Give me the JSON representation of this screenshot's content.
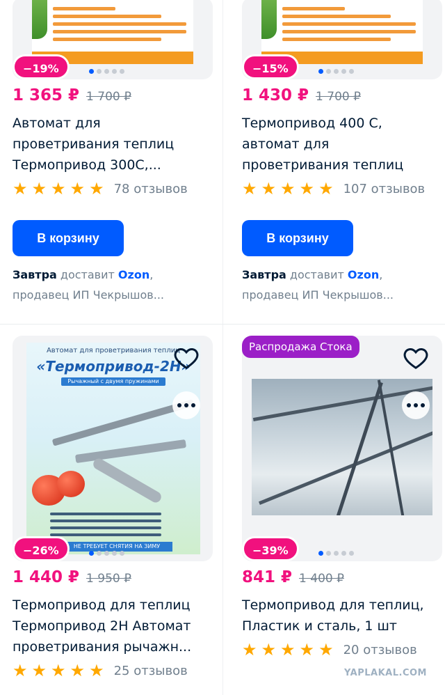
{
  "products": [
    {
      "discount": "−19%",
      "price": "1 365 ₽",
      "old_price": "1 700 ₽",
      "title_lines": [
        "Автомат для",
        "проветривания теплиц",
        "Термопривод 300С,..."
      ],
      "reviews": "78 отзывов",
      "button": "В корзину",
      "delivery_when": "Завтра",
      "delivery_mid": "доставит",
      "delivery_by": "Ozon",
      "delivery_rest": ",",
      "seller": "продавец ИП Чекрышов..."
    },
    {
      "discount": "−15%",
      "price": "1 430 ₽",
      "old_price": "1 700 ₽",
      "title_lines": [
        "Термопривод 400 С,",
        "автомат для",
        "проветривания теплиц"
      ],
      "reviews": "107 отзывов",
      "button": "В корзину",
      "delivery_when": "Завтра",
      "delivery_mid": "доставит",
      "delivery_by": "Ozon",
      "delivery_rest": ",",
      "seller": "продавец ИП Чекрышов..."
    },
    {
      "discount": "−26%",
      "price": "1 440 ₽",
      "old_price": "1 950 ₽",
      "title_lines": [
        "Термопривод для теплиц",
        "Термопривод 2Н Автомат",
        "проветривания рычажн..."
      ],
      "reviews": "25 отзывов",
      "image_head": "Автомат для проветривания теплиц",
      "image_brand": "«Термопривод-2Н»",
      "image_sub": "Рычажный с двумя пружинами",
      "image_foot": "НЕ ТРЕБУЕТ СНЯТИЯ НА ЗИМУ"
    },
    {
      "discount": "−39%",
      "price": "841 ₽",
      "old_price": "1 400 ₽",
      "title_lines": [
        "Термопривод для теплиц,",
        "Пластик и сталь, 1 шт"
      ],
      "reviews": "20 отзывов",
      "promo_tag": "Распродажа Стока"
    }
  ],
  "watermark": "YAPLAKAL.COM",
  "icons": {
    "favorite": "heart-icon",
    "more": "more-dots-icon",
    "star": "star-icon"
  },
  "colors": {
    "price": "#f1117e",
    "button": "#005bff",
    "star": "#ffa800",
    "promo": "#9b1fc7"
  }
}
